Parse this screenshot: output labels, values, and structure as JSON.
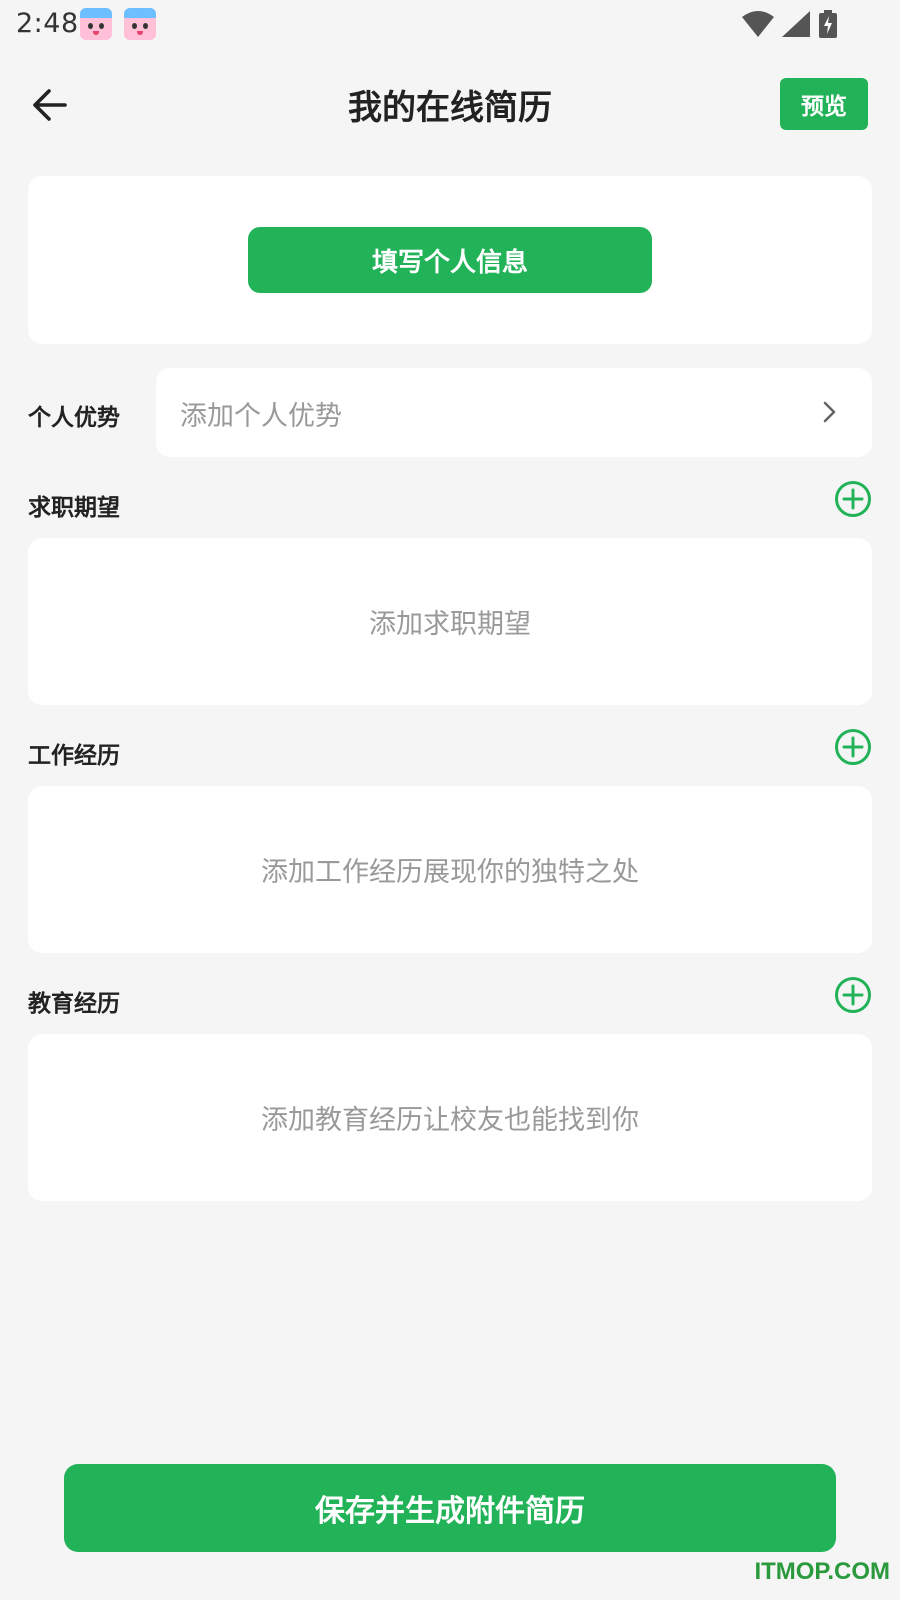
{
  "status_bar": {
    "time": "2:48",
    "icons": [
      "app-icon-unicorn",
      "app-icon-unicorn",
      "wifi-icon",
      "cell-signal-icon",
      "battery-charging-icon"
    ]
  },
  "nav": {
    "back_icon": "arrow-left-icon",
    "title": "我的在线简历",
    "preview_label": "预览"
  },
  "personal_info": {
    "button_label": "填写个人信息"
  },
  "advantage": {
    "label": "个人优势",
    "placeholder": "添加个人优势",
    "chevron_icon": "chevron-right-icon"
  },
  "sections": [
    {
      "title": "求职期望",
      "empty_text": "添加求职期望",
      "add_icon": "plus-circle-icon"
    },
    {
      "title": "工作经历",
      "empty_text": "添加工作经历展现你的独特之处",
      "add_icon": "plus-circle-icon"
    },
    {
      "title": "教育经历",
      "empty_text": "添加教育经历让校友也能找到你",
      "add_icon": "plus-circle-icon"
    }
  ],
  "footer": {
    "save_label": "保存并生成附件简历",
    "watermark": "ITMOP.COM"
  },
  "colors": {
    "primary_green": "#22b359",
    "background": "#f5f5f5",
    "card": "#ffffff",
    "placeholder_gray": "#999999"
  }
}
